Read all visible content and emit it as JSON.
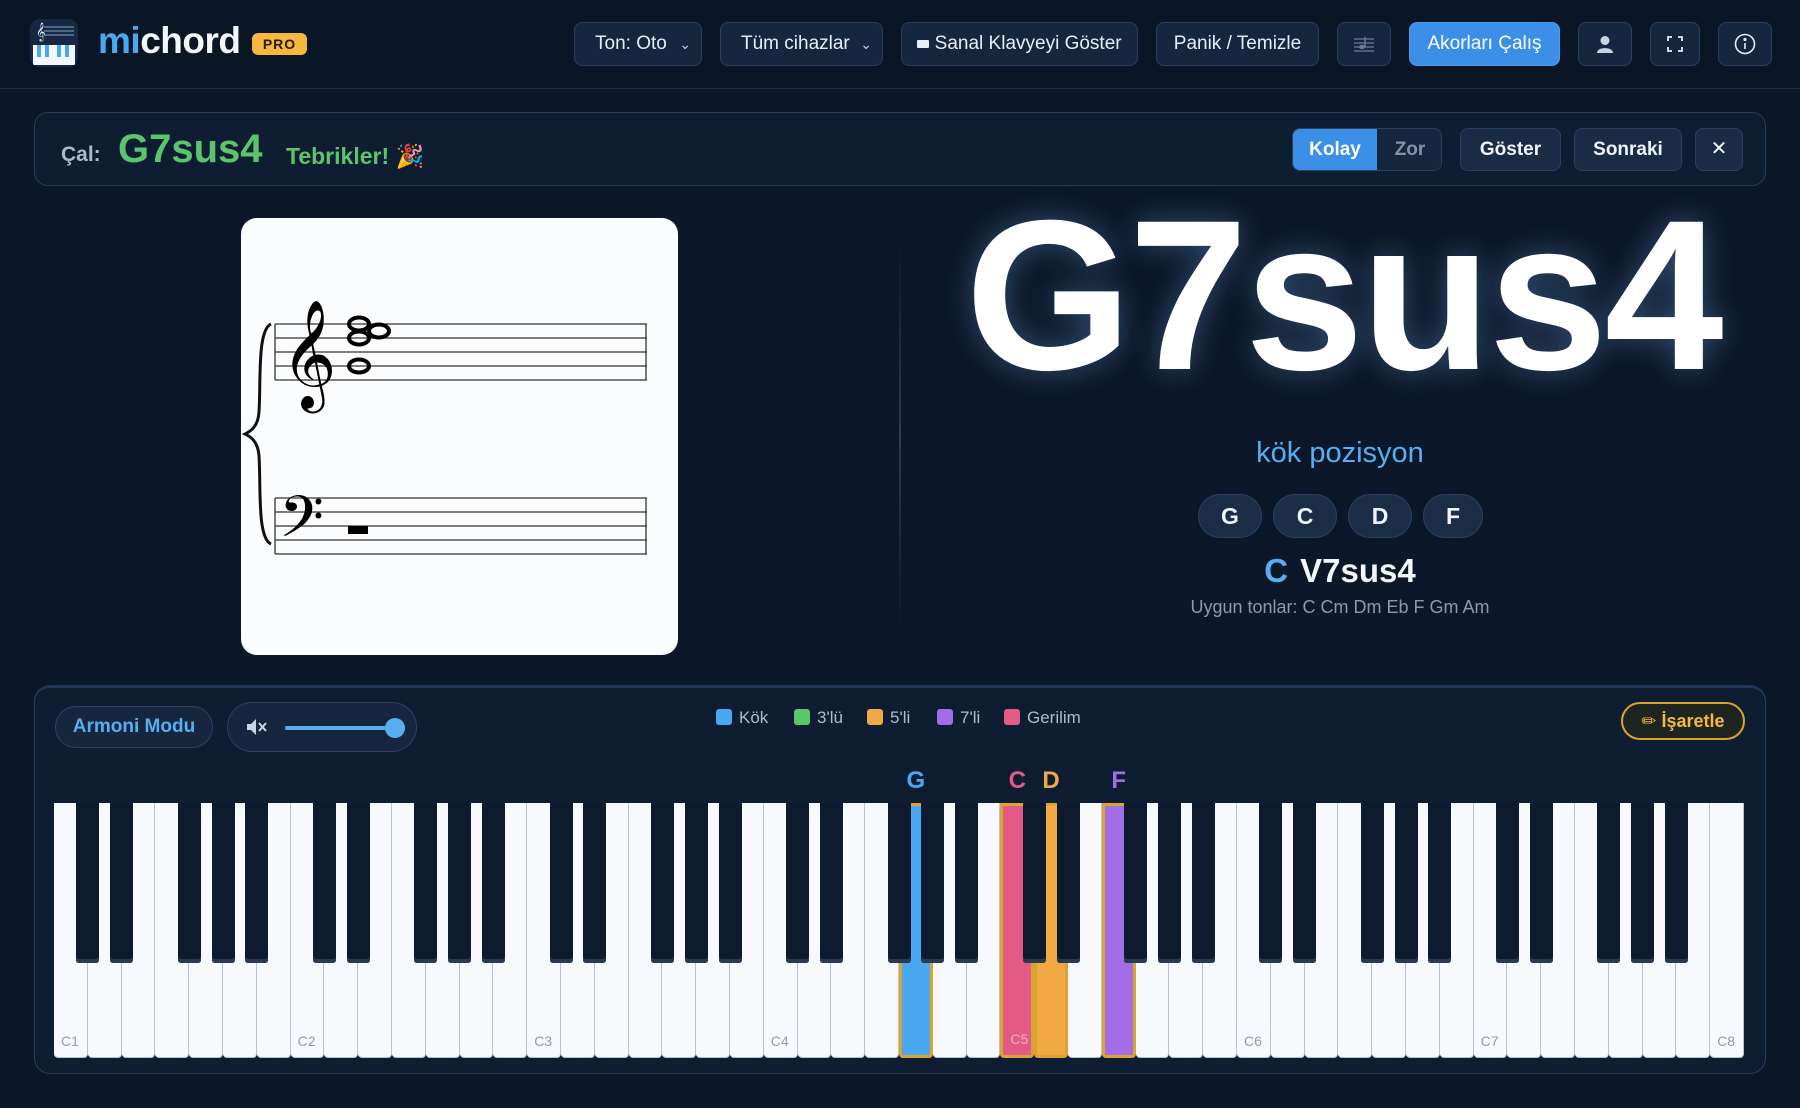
{
  "header": {
    "logo_mi": "mi",
    "logo_chord": "chord",
    "pro_badge": "PRO",
    "tone_select": "Ton: Oto",
    "devices_select": "Tüm cihazlar",
    "virtual_keyboard": "Sanal Klavyeyi Göster",
    "panic": "Panik / Temizle",
    "play_chords": "Akorları Çalış"
  },
  "playbar": {
    "label": "Çal:",
    "chord": "G7sus4",
    "congrats": "Tebrikler! 🎉",
    "easy": "Kolay",
    "hard": "Zor",
    "show": "Göster",
    "next": "Sonraki",
    "close": "✕"
  },
  "chord": {
    "name": "G7sus4",
    "position": "kök pozisyon",
    "notes": [
      "G",
      "C",
      "D",
      "F"
    ],
    "key": "C",
    "roman": "V7sus4",
    "keys_label": "Uygun tonlar: C Cm Dm Eb F Gm Am"
  },
  "controls": {
    "harmony_mode": "Armoni Modu",
    "volume": 1.0,
    "mark_button": "✏ İşaretle"
  },
  "legend": [
    {
      "label": "Kök",
      "color": "#4aa8f0"
    },
    {
      "label": "3'lü",
      "color": "#5cc46a"
    },
    {
      "label": "5'li",
      "color": "#f2a844"
    },
    {
      "label": "7'li",
      "color": "#a26de6"
    },
    {
      "label": "Gerilim",
      "color": "#e45a86"
    }
  ],
  "keyboard": {
    "octave_labels": [
      "C1",
      "C2",
      "C3",
      "C4",
      "C5",
      "C6",
      "C7",
      "C8"
    ],
    "highlighted": [
      {
        "note": "G",
        "octave": 4,
        "color": "#4aa8f0"
      },
      {
        "note": "C",
        "octave": 5,
        "color": "#e45a86"
      },
      {
        "note": "D",
        "octave": 5,
        "color": "#f2a844"
      },
      {
        "note": "F",
        "octave": 5,
        "color": "#a26de6"
      }
    ]
  }
}
